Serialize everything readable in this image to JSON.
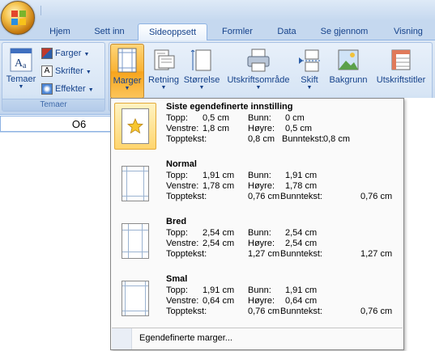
{
  "app": {
    "tabs": [
      {
        "label": "Hjem"
      },
      {
        "label": "Sett inn"
      },
      {
        "label": "Sideoppsett",
        "active": true
      },
      {
        "label": "Formler"
      },
      {
        "label": "Data"
      },
      {
        "label": "Se gjennom"
      },
      {
        "label": "Visning"
      }
    ]
  },
  "ribbon": {
    "themes_group": {
      "label": "Temaer",
      "themes_button": "Temaer",
      "colors": "Farger",
      "fonts": "Skrifter",
      "effects": "Effekter"
    },
    "page_setup_group": {
      "margins": "Marger",
      "orientation": "Retning",
      "size": "Størrelse",
      "print_area": "Utskriftsområde",
      "breaks": "Skift",
      "background": "Bakgrunn",
      "print_titles": "Utskriftstitler"
    }
  },
  "namebox": {
    "value": "O6"
  },
  "margins_menu": {
    "items": [
      {
        "title": "Siste egendefinerte innstilling",
        "selected": true,
        "top_label": "Topp:",
        "top": "0,5 cm",
        "bottom_label": "Bunn:",
        "bottom": "0 cm",
        "left_label": "Venstre:",
        "left": "1,8 cm",
        "right_label": "Høyre:",
        "right": "0,5 cm",
        "header_label": "Topptekst:",
        "header": "0,8 cm",
        "footer_label": "Bunntekst:",
        "footer": "0,8 cm"
      },
      {
        "title": "Normal",
        "top_label": "Topp:",
        "top": "1,91 cm",
        "bottom_label": "Bunn:",
        "bottom": "1,91 cm",
        "left_label": "Venstre:",
        "left": "1,78 cm",
        "right_label": "Høyre:",
        "right": "1,78 cm",
        "header_label": "Topptekst:",
        "header": "0,76 cm",
        "footer_label": "Bunntekst:",
        "footer": "0,76 cm"
      },
      {
        "title": "Bred",
        "top_label": "Topp:",
        "top": "2,54 cm",
        "bottom_label": "Bunn:",
        "bottom": "2,54 cm",
        "left_label": "Venstre:",
        "left": "2,54 cm",
        "right_label": "Høyre:",
        "right": "2,54 cm",
        "header_label": "Topptekst:",
        "header": "1,27 cm",
        "footer_label": "Bunntekst:",
        "footer": "1,27 cm"
      },
      {
        "title": "Smal",
        "top_label": "Topp:",
        "top": "1,91 cm",
        "bottom_label": "Bunn:",
        "bottom": "1,91 cm",
        "left_label": "Venstre:",
        "left": "0,64 cm",
        "right_label": "Høyre:",
        "right": "0,64 cm",
        "header_label": "Topptekst:",
        "header": "0,76 cm",
        "footer_label": "Bunntekst:",
        "footer": "0,76 cm"
      }
    ],
    "custom_margins": "Egendefinerte marger..."
  },
  "colors": {
    "accent": "#f7a41c",
    "ribbon_text": "#15428b",
    "border": "#8db2e3"
  },
  "icons": [
    "office-logo-icon",
    "themes-icon",
    "colors-icon",
    "fonts-icon",
    "effects-icon",
    "margins-icon",
    "orientation-icon",
    "size-icon",
    "print-area-icon",
    "breaks-icon",
    "background-icon",
    "print-titles-icon",
    "star-icon",
    "page-icon"
  ]
}
